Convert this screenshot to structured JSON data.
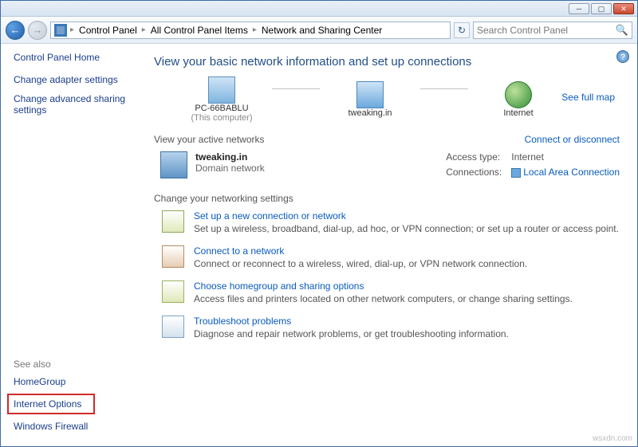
{
  "window": {
    "min": "─",
    "max": "▢",
    "close": "✕"
  },
  "nav": {
    "back": "←",
    "forward": "→",
    "refresh": "↻"
  },
  "breadcrumb": {
    "root": "Control Panel",
    "mid": "All Control Panel Items",
    "leaf": "Network and Sharing Center"
  },
  "search": {
    "placeholder": "Search Control Panel"
  },
  "sidebar": {
    "home": "Control Panel Home",
    "task1": "Change adapter settings",
    "task2": "Change advanced sharing settings",
    "seealso_h": "See also",
    "seealso1": "HomeGroup",
    "seealso2": "Internet Options",
    "seealso3": "Windows Firewall"
  },
  "main": {
    "heading": "View your basic network information and set up connections",
    "help": "?",
    "map": {
      "pc": "PC-66BABLU",
      "pc_sub": "(This computer)",
      "router": "tweaking.in",
      "internet": "Internet",
      "seefull": "See full map"
    },
    "active": {
      "label": "View your active networks",
      "connect": "Connect or disconnect",
      "name": "tweaking.in",
      "type": "Domain network",
      "access_l": "Access type:",
      "access_v": "Internet",
      "conn_l": "Connections:",
      "conn_v": "Local Area Connection"
    },
    "change_h": "Change your networking settings",
    "opt1": {
      "title": "Set up a new connection or network",
      "desc": "Set up a wireless, broadband, dial-up, ad hoc, or VPN connection; or set up a router or access point."
    },
    "opt2": {
      "title": "Connect to a network",
      "desc": "Connect or reconnect to a wireless, wired, dial-up, or VPN network connection."
    },
    "opt3": {
      "title": "Choose homegroup and sharing options",
      "desc": "Access files and printers located on other network computers, or change sharing settings."
    },
    "opt4": {
      "title": "Troubleshoot problems",
      "desc": "Diagnose and repair network problems, or get troubleshooting information."
    }
  },
  "watermark": "wsxdn.com"
}
